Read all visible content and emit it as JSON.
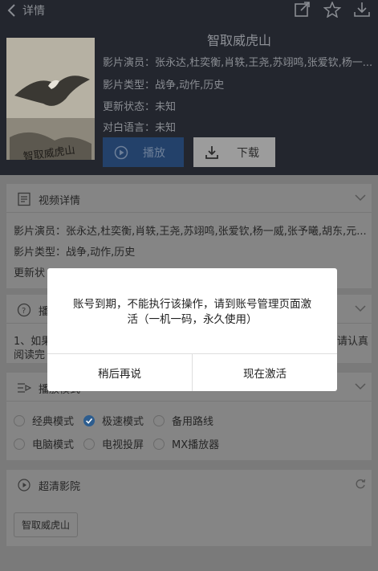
{
  "topbar": {
    "back_label": "详情"
  },
  "movie": {
    "title": "智取威虎山",
    "actors": "影片演员：张永达,杜奕衡,肖轶,王尧,苏翊鸣,张爱钦,杨一...",
    "genre": "影片类型：战争,动作,历史",
    "status": "更新状态：未知",
    "language": "对白语言：未知",
    "play_label": "播放",
    "download_label": "下载"
  },
  "details_card": {
    "title": "视频详情",
    "actors": "影片演员：张永达,杜奕衡,肖轶,王尧,苏翊鸣,张爱钦,杨一威,张予曦,胡东,元...",
    "genre": "影片类型：战争,动作,历史",
    "status_partial": "更新状"
  },
  "notice_card": {
    "title_partial": "播",
    "body_left": "1、如果",
    "body_right": "请认真",
    "body_line2": "阅读完"
  },
  "mode_card": {
    "title": "播放模式",
    "options": [
      "经典模式",
      "极速模式",
      "备用路线",
      "电脑模式",
      "电视投屏",
      "MX播放器"
    ],
    "selected": "极速模式"
  },
  "cinema_card": {
    "title": "超清影院",
    "chip": "智取威虎山"
  },
  "dialog": {
    "message": "账号到期，不能执行该操作，请到账号管理页面激活（一机一码，永久使用）",
    "later_label": "稍后再说",
    "activate_label": "现在激活"
  },
  "colors": {
    "accent": "#2d5d8f",
    "overlay": "#7a7a7a",
    "header_bg": "#23262e"
  }
}
